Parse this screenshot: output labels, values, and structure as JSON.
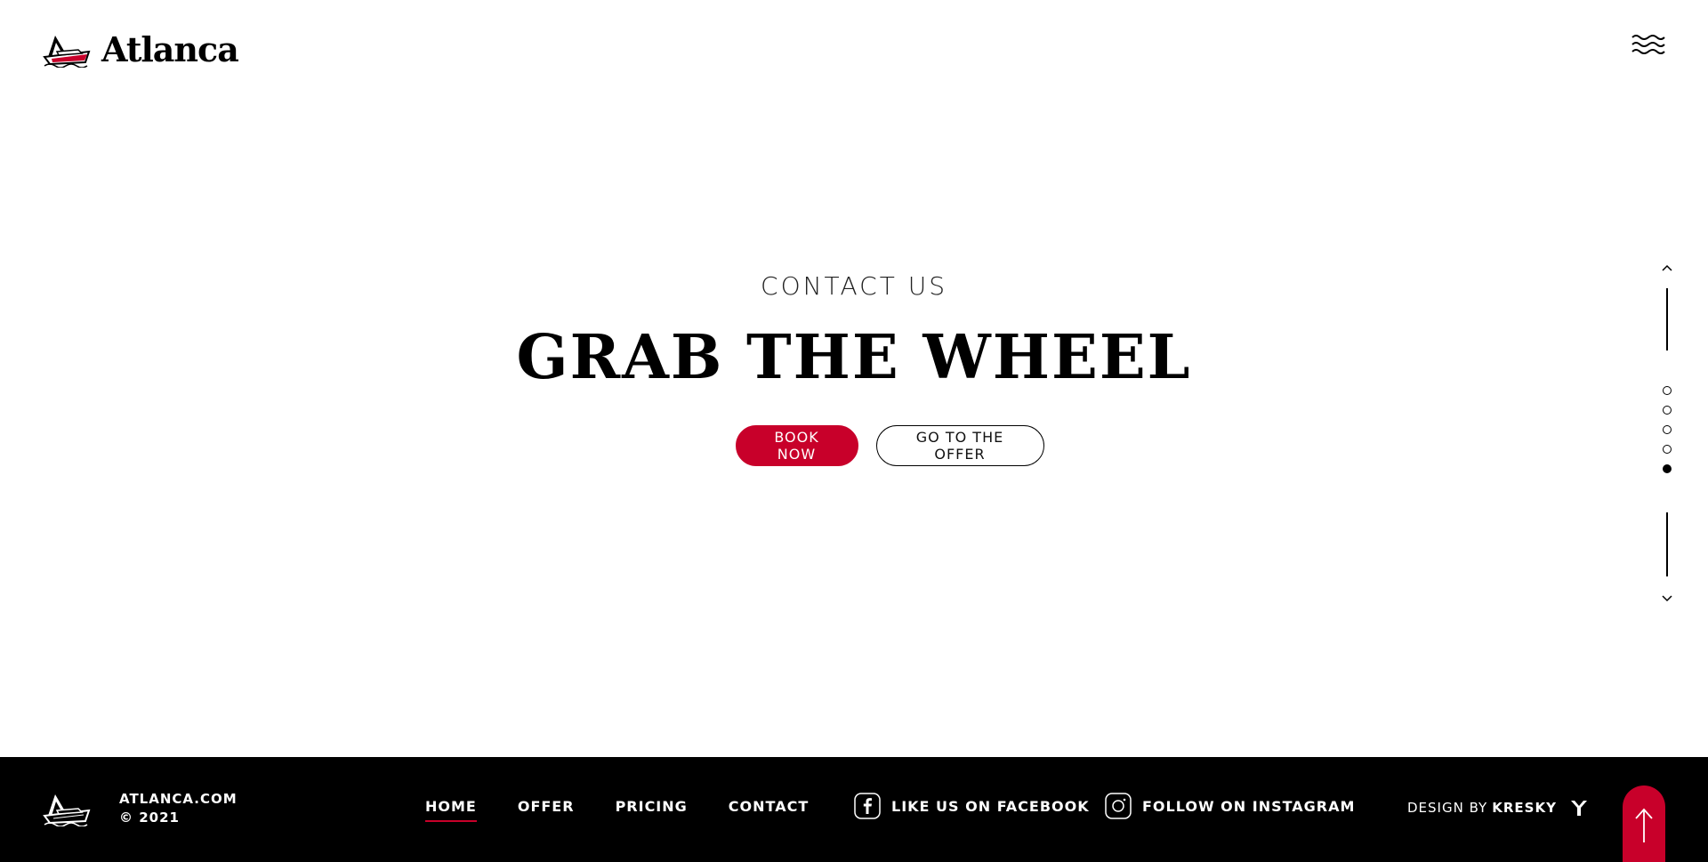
{
  "header": {
    "brand_name": "Atlanca",
    "menu_icon": "waves-menu-icon"
  },
  "hero": {
    "eyebrow": "CONTACT US",
    "title": "GRAB THE WHEEL",
    "primary_button": "BOOK NOW",
    "secondary_button": "GO TO THE OFFER"
  },
  "pager": {
    "up_icon": "chevron-up-icon",
    "down_icon": "chevron-down-icon",
    "dots_total": 5,
    "active_index": 4
  },
  "footer": {
    "site_name": "ATLANCA.COM",
    "copyright": "© 2021",
    "nav": [
      {
        "label": "HOME",
        "active": true
      },
      {
        "label": "OFFER",
        "active": false
      },
      {
        "label": "PRICING",
        "active": false
      },
      {
        "label": "CONTACT",
        "active": false
      }
    ],
    "facebook_label": "LIKE US ON FACEBOOK",
    "instagram_label": "FOLLOW ON INSTAGRAM",
    "design_by_prefix": "DESIGN BY",
    "design_by_name": "KRESKY",
    "back_to_top_icon": "arrow-up-icon"
  },
  "colors": {
    "accent": "#c8002a",
    "footer_bg": "#000000",
    "text": "#000000"
  }
}
